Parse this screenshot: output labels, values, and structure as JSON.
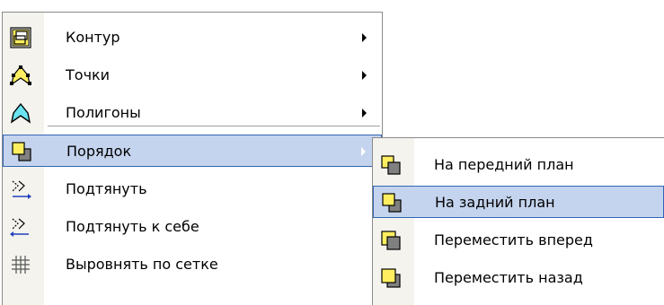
{
  "colors": {
    "highlight_fill": "#c5d4ee",
    "highlight_border": "#3166b6",
    "gutter": "#f4f3ee",
    "icon_yellow": "#ffef60",
    "icon_gray": "#808080",
    "icon_cyan": "#6ae4f0"
  },
  "main_menu": {
    "items": [
      {
        "label": "Контур",
        "icon": "contour-icon",
        "has_submenu": true,
        "highlighted": false
      },
      {
        "label": "Точки",
        "icon": "points-icon",
        "has_submenu": true,
        "highlighted": false
      },
      {
        "label": "Полигоны",
        "icon": "polygons-icon",
        "has_submenu": true,
        "highlighted": false
      },
      {
        "label": "Порядок",
        "icon": "order-icon",
        "has_submenu": true,
        "highlighted": true
      },
      {
        "label": "Подтянуть",
        "icon": "snap-icon",
        "has_submenu": false,
        "highlighted": false
      },
      {
        "label": "Подтянуть к себе",
        "icon": "snap-to-self-icon",
        "has_submenu": false,
        "highlighted": false
      },
      {
        "label": "Выровнять по сетке",
        "icon": "grid-icon",
        "has_submenu": false,
        "highlighted": false
      }
    ]
  },
  "sub_menu": {
    "items": [
      {
        "label": "На передний план",
        "icon": "bring-to-front-icon",
        "highlighted": false
      },
      {
        "label": "На задний план",
        "icon": "send-to-back-icon",
        "highlighted": true
      },
      {
        "label": "Переместить вперед",
        "icon": "bring-forward-icon",
        "highlighted": false
      },
      {
        "label": "Переместить назад",
        "icon": "send-backward-icon",
        "highlighted": false
      }
    ]
  }
}
